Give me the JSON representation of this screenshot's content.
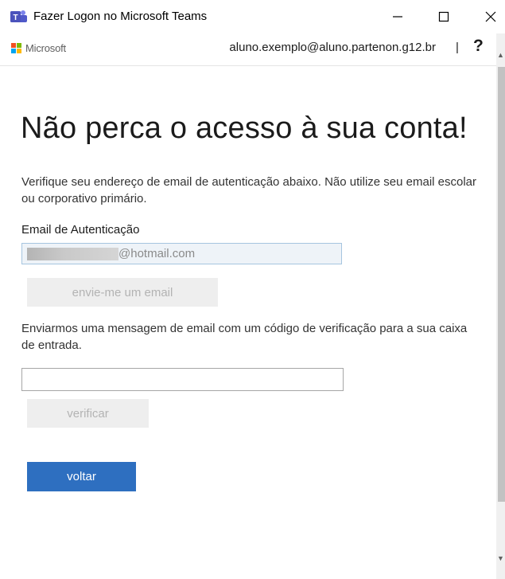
{
  "window": {
    "title": "Fazer Logon no Microsoft Teams",
    "controls": [
      "minimize-icon",
      "maximize-icon",
      "close-icon"
    ]
  },
  "header": {
    "brand": "Microsoft",
    "account": "aluno.exemplo@aluno.partenon.g12.br",
    "separator": "|",
    "help": "?"
  },
  "main": {
    "heading": "Não perca o acesso à sua conta!",
    "description": "Verifique seu endereço de email de autenticação abaixo. Não utilize seu email escolar ou corporativo primário.",
    "email_label": "Email de Autenticação",
    "email_value_suffix": "@hotmail.com",
    "send_button": "envie-me um email",
    "sent_message": "Enviarmos uma mensagem de email com um código de verificação para a sua caixa de entrada.",
    "code_value": "",
    "verify_button": "verificar",
    "back_button": "voltar"
  },
  "colors": {
    "primary_button": "#2e6fc0",
    "disabled_button": "#eeeeee",
    "disabled_text": "#b3b3b3",
    "teams_purple": "#5059c9"
  }
}
